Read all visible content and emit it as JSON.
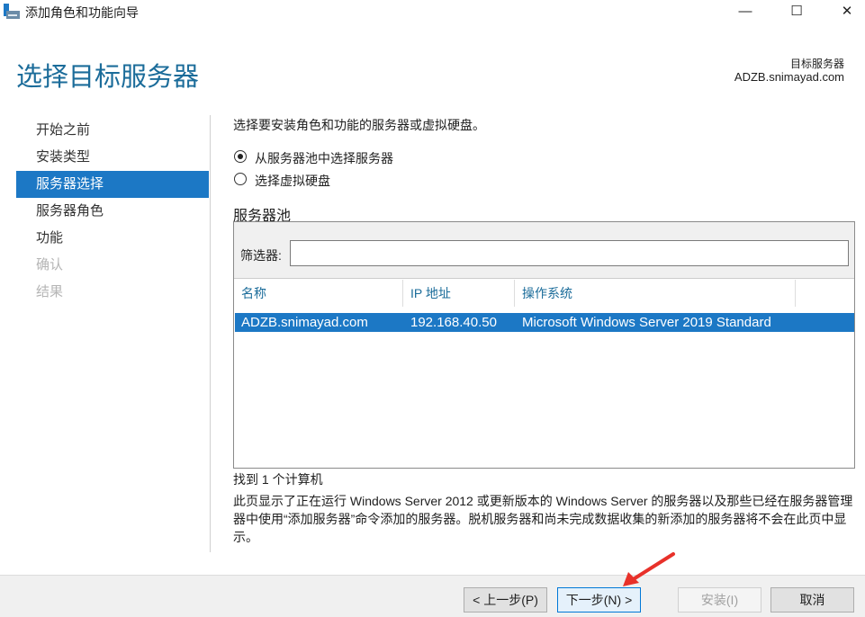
{
  "window": {
    "title": "添加角色和功能向导",
    "min_icon": "minimize-icon",
    "max_icon": "maximize-icon",
    "close_icon": "close-icon"
  },
  "header": {
    "title": "选择目标服务器",
    "target_label": "目标服务器",
    "target_value": "ADZB.snimayad.com"
  },
  "nav": {
    "items": [
      {
        "label": "开始之前",
        "state": "normal"
      },
      {
        "label": "安装类型",
        "state": "normal"
      },
      {
        "label": "服务器选择",
        "state": "selected"
      },
      {
        "label": "服务器角色",
        "state": "normal"
      },
      {
        "label": "功能",
        "state": "normal"
      },
      {
        "label": "确认",
        "state": "disabled"
      },
      {
        "label": "结果",
        "state": "disabled"
      }
    ]
  },
  "main": {
    "instruction": "选择要安装角色和功能的服务器或虚拟硬盘。",
    "radio_pool": "从服务器池中选择服务器",
    "radio_vhd": "选择虚拟硬盘",
    "selected_option": "pool",
    "pool_title": "服务器池",
    "filter_label": "筛选器:",
    "filter_value": "",
    "columns": [
      "名称",
      "IP 地址",
      "操作系统"
    ],
    "rows": [
      {
        "name": "ADZB.snimayad.com",
        "ip": "192.168.40.50",
        "os": "Microsoft Windows Server 2019 Standard"
      }
    ],
    "found": "找到 1 个计算机",
    "note": "此页显示了正在运行 Windows Server 2012 或更新版本的 Windows Server 的服务器以及那些已经在服务器管理器中使用“添加服务器”命令添加的服务器。脱机服务器和尚未完成数据收集的新添加的服务器将不会在此页中显示。"
  },
  "footer": {
    "prev": "< 上一步(P)",
    "next": "下一步(N) >",
    "install": "安装(I)",
    "cancel": "取消"
  },
  "colors": {
    "accent": "#1c78c5",
    "heading": "#1b6c9a",
    "annotation_arrow": "#e8312a"
  }
}
